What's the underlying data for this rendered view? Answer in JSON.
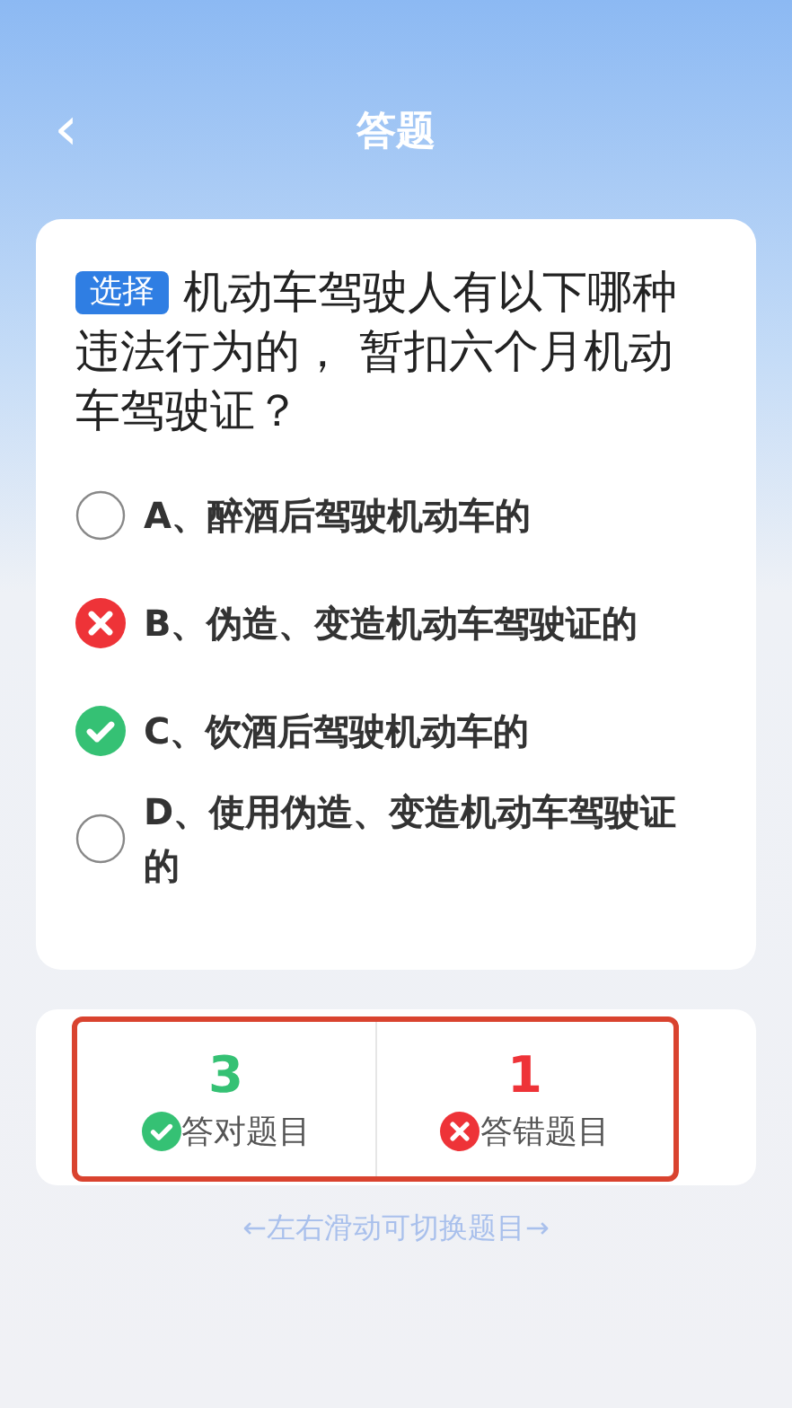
{
  "header": {
    "back": "‹",
    "title": "答题"
  },
  "question": {
    "tag": "选择",
    "text": "机动车驾驶人有以下哪种违法行为的， 暂扣六个月机动车驾驶证？"
  },
  "options": [
    {
      "label": "A、醉酒后驾驶机动车的",
      "kind": "empty"
    },
    {
      "label": "B、伪造、变造机动车驾驶证的",
      "kind": "wrong"
    },
    {
      "label": "C、饮酒后驾驶机动车的",
      "kind": "right"
    },
    {
      "label": "D、使用伪造、变造机动车驾驶证的",
      "kind": "empty"
    }
  ],
  "stats": [
    {
      "kind": "right",
      "count": "3",
      "label": "答对题目"
    },
    {
      "kind": "wrong",
      "count": "1",
      "label": "答错题目"
    }
  ],
  "hint": "←左右滑动可切换题目→"
}
